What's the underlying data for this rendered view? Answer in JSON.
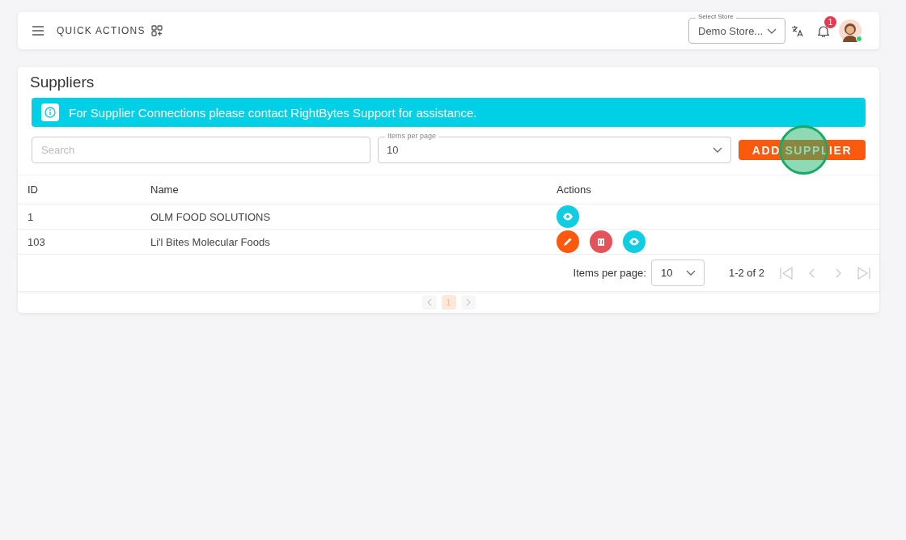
{
  "topbar": {
    "quick_actions": "QUICK ACTIONS",
    "store_select": {
      "label": "Select Store",
      "value": "Demo Store..."
    },
    "notifications": {
      "count": "1"
    },
    "avatar": {
      "online": true
    }
  },
  "page": {
    "title": "Suppliers",
    "alert": "For Supplier Connections please contact RightBytes Support for assistance.",
    "search": {
      "placeholder": "Search"
    },
    "items_per_page": {
      "label": "Items per page",
      "value": "10"
    },
    "add_button": "ADD SUPPLIER",
    "click_marker": true,
    "table": {
      "columns": [
        "ID",
        "Name",
        "Actions"
      ],
      "rows": [
        {
          "id": "1",
          "name": "OLM FOOD SOLUTIONS",
          "actions": [
            {
              "kind": "view"
            }
          ]
        },
        {
          "id": "103",
          "name": "Li'l Bites Molecular Foods",
          "actions": [
            {
              "kind": "edit"
            },
            {
              "kind": "delete"
            },
            {
              "kind": "view"
            }
          ]
        }
      ]
    },
    "paginator": {
      "label": "Items per page:",
      "page_size": "10",
      "range": "1-2 of 2"
    },
    "pager": {
      "pages": [
        {
          "label": "1",
          "selected": true
        }
      ]
    }
  }
}
